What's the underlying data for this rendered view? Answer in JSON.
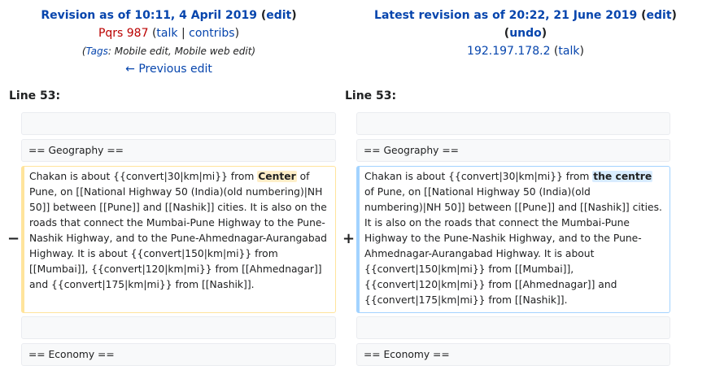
{
  "left": {
    "revision_prefix": "Revision as of 10:11, 4 April 2019",
    "edit": "edit",
    "user": "Pqrs 987",
    "talk": "talk",
    "contribs": "contribs",
    "tags_label": "Tags",
    "tags": "Mobile edit, Mobile web edit",
    "prev": "← Previous edit",
    "line_label": "Line 53:"
  },
  "right": {
    "revision_prefix": "Latest revision as of 20:22, 21 June 2019",
    "edit": "edit",
    "undo": "undo",
    "ip": "192.197.178.2",
    "talk": "talk",
    "line_label": "Line 53:"
  },
  "diff": {
    "geography": "== Geography ==",
    "economy": "== Economy ==",
    "minus": "−",
    "plus": "+",
    "left_before": "Chakan is about {{convert|30|km|mi}} from ",
    "left_changed": "Center",
    "left_after": " of Pune, on [[National Highway 50 (India)(old numbering)|NH 50]] between [[Pune]] and [[Nashik]] cities. It is also on the roads that connect the Mumbai-Pune Highway to the Pune-Nashik Highway, and to the Pune-Ahmednagar-Aurangabad Highway. It is about {{convert|150|km|mi}} from [[Mumbai]], {{convert|120|km|mi}} from [[Ahmednagar]] and {{convert|175|km|mi}} from [[Nashik]].",
    "right_before": "Chakan is about {{convert|30|km|mi}} from ",
    "right_changed": "the centre",
    "right_after": " of Pune, on [[National Highway 50 (India)(old numbering)|NH 50]] between [[Pune]] and [[Nashik]] cities. It is also on the roads that connect the Mumbai-Pune Highway to the Pune-Nashik Highway, and to the Pune-Ahmednagar-Aurangabad Highway. It is about {{convert|150|km|mi}} from [[Mumbai]], {{convert|120|km|mi}} from [[Ahmednagar]] and {{convert|175|km|mi}} from [[Nashik]]."
  }
}
